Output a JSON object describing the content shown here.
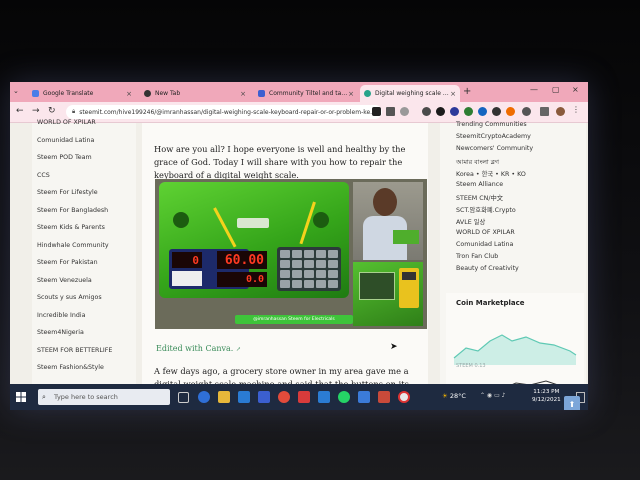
{
  "browser": {
    "tabs": [
      {
        "title": "Google Translate",
        "active": false
      },
      {
        "title": "New Tab",
        "active": false
      },
      {
        "title": "Community Tiltel and tag - Dyn",
        "active": false
      },
      {
        "title": "Digital weighing scale keyboard",
        "active": true
      }
    ],
    "new_tab_symbol": "+",
    "close_symbol": "×",
    "address": "steemit.com/hive199246/@imranhassan/digital-weighing-scale-keyboard-repair-or-or-problem-ke..."
  },
  "left_nav": {
    "items": [
      "WORLD OF XPILAR",
      "Comunidad Latina",
      "Steem POD Team",
      "CCS",
      "Steem For Lifestyle",
      "Steem For Bangladesh",
      "Steem Kids & Parents",
      "Hindwhale Community",
      "Steem For Pakistan",
      "Steem Venezuela",
      "Scouts y sus Amigos",
      "Incredible India",
      "Steem4Nigeria",
      "STEEM FOR BETTERLIFE",
      "Steem Fashion&Style"
    ]
  },
  "article": {
    "intro": "How are you all? I hope everyone is well and healthy by the grace of God. Today I will share with you how to repair the keyboard of a digital weight scale.",
    "image_display_left": "0",
    "image_display_main": "60.00",
    "image_display_lower": "0.0",
    "image_caption": "@imranhassan Steem for Electricals",
    "canva_link": "Edited with Canva.",
    "paragraph": "A few days ago, a grocery store owner in my area gave me a digital weight scale machine and said that the buttons on its keyboard were"
  },
  "right_nav": {
    "items": [
      "Trending Communities",
      "SteemitCryptoAcademy",
      "Newcomers' Community",
      "আমার বাংলা ব্লগ",
      "Korea • 한국 • KR • KO",
      "Steem Alliance",
      "STEEM CN/中文",
      "SCT.암호화폐.Crypto",
      "AVLE 일상",
      "WORLD OF XPILAR",
      "Comunidad Latina",
      "Tron Fan Club",
      "Beauty of Creativity"
    ],
    "coin_title": "Coin Marketplace",
    "coin_label": "STEEM 0.13"
  },
  "taskbar": {
    "search_placeholder": "Type here to search",
    "weather": "28°C",
    "time": "11:23 PM",
    "date": "9/12/2021"
  },
  "colors": {
    "tab_bar": "#f0a8ba",
    "active_tab": "#fbe6ec",
    "taskbar": "#1e2a40",
    "chart_line": "#5fc9b4",
    "canva_link": "#3a8c5a"
  }
}
